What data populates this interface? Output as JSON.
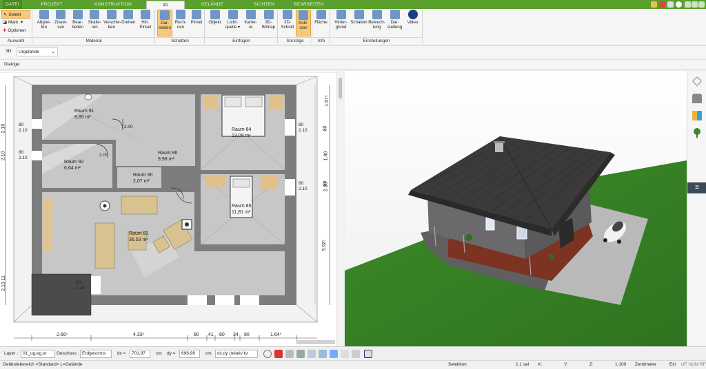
{
  "tabs": [
    {
      "label": "DATEI"
    },
    {
      "label": "PROJEKT"
    },
    {
      "label": "KONSTRUKTION"
    },
    {
      "label": "3D"
    },
    {
      "label": "GELÄNDE"
    },
    {
      "label": "SICHTEN"
    },
    {
      "label": "BEARBEITEN"
    }
  ],
  "ribbon": {
    "left": {
      "selekt": "Selekt",
      "mark": "Mark.",
      "optionen": "Optionen",
      "group": "Auswahl"
    },
    "material": {
      "group": "Material",
      "buttons": [
        {
          "line1": "Abgrei-",
          "line2": "fen"
        },
        {
          "line1": "Zuwei-",
          "line2": "sen"
        },
        {
          "line1": "Bear-",
          "line2": "beiten"
        },
        {
          "line1": "Skalie-",
          "line2": "ren"
        },
        {
          "line1": "Verschie-",
          "line2": "ben"
        },
        {
          "line1": "Drehen",
          "line2": ""
        },
        {
          "line1": "Hin.",
          "line2": "Pinsel"
        }
      ]
    },
    "schatten": {
      "group": "Schatten",
      "buttons": [
        {
          "line1": "Dar-",
          "line2": "stellen"
        },
        {
          "line1": "Rech-",
          "line2": "nen"
        },
        {
          "line1": "Pinsel",
          "line2": ""
        }
      ]
    },
    "einfuegen": {
      "group": "Einfügen",
      "buttons": [
        {
          "line1": "Objekt",
          "line2": ""
        },
        {
          "line1": "Licht-",
          "line2": "quelle ▾"
        },
        {
          "line1": "Kame-",
          "line2": "ra"
        },
        {
          "line1": "3D-",
          "line2": "Bitmap"
        }
      ]
    },
    "sonstige": {
      "group": "Sonstige",
      "buttons": [
        {
          "line1": "3D-",
          "line2": "Schnitt"
        },
        {
          "line1": "Kolli-",
          "line2": "sion"
        }
      ]
    },
    "info": {
      "group": "Info",
      "buttons": [
        {
          "line1": "Fläche",
          "line2": ""
        }
      ]
    },
    "einstellungen": {
      "group": "Einstellungen",
      "buttons": [
        {
          "line1": "Hinter-",
          "line2": "grund"
        },
        {
          "line1": "Schatten",
          "line2": ""
        },
        {
          "line1": "Beleuch-",
          "line2": "tung"
        },
        {
          "line1": "Dar-",
          "line2": "stellung"
        },
        {
          "line1": "Video",
          "line2": ""
        }
      ]
    }
  },
  "subbar": {
    "mode": "3D",
    "terrain": "Urgelände"
  },
  "dialoge_label": "Dialoge:",
  "plan": {
    "rooms": [
      {
        "name": "Raum 91",
        "area": "8,85 m²"
      },
      {
        "name": "Raum 92",
        "area": "6,64 m²"
      },
      {
        "name": "Raum 86",
        "area": "9,98 m²"
      },
      {
        "name": "Raum 90",
        "area": "2,07 m²"
      },
      {
        "name": "Raum 84",
        "area": "13,09 m²"
      },
      {
        "name": "Raum 85",
        "area": "11,81 m²"
      },
      {
        "name": "Raum 83",
        "area": "36,53 m²"
      }
    ],
    "bottom_dims": [
      "2.66⁵",
      "4.33⁵",
      "80",
      "41",
      "80",
      "34",
      "80",
      "1.64⁵"
    ],
    "right_dims": [
      "1.57⁵",
      "80",
      "1.80",
      "80",
      "2.10",
      "5.02⁵"
    ],
    "left_dims": [
      "2.10",
      "2.10",
      "2.10 11"
    ],
    "window_labels": [
      "80",
      "2.10"
    ],
    "door_labels": [
      "2.00"
    ]
  },
  "toolbar": {
    "layer_label": "Layer :",
    "layer_value": "01_ug,eg,or",
    "geschoss_label": "Geschoss :",
    "geschoss_value": "Erdgeschos",
    "dx_label": "dx =",
    "dx_value": "701,97",
    "dy_label": "dy =",
    "dy_value": "698,99",
    "unit": "cm",
    "mode": "dx,dy (relativ kz"
  },
  "status": {
    "left": "Geländebereich <Standard> L=Gelände",
    "mode": "Selektion",
    "selcount": "1:1 sel",
    "x": "X:",
    "y": "Y:",
    "z": "Z:",
    "scale": "1:100",
    "unit": "Zentimeter",
    "ein": "Ein",
    "flags": "UF NUM RF"
  },
  "colors": {
    "tab_green": "#5aa02c",
    "selected_orange": "#f7c97c",
    "roof": "#3a3a3a",
    "grass": "#3f8a2a",
    "plan_gray": "#7d7d7d"
  }
}
